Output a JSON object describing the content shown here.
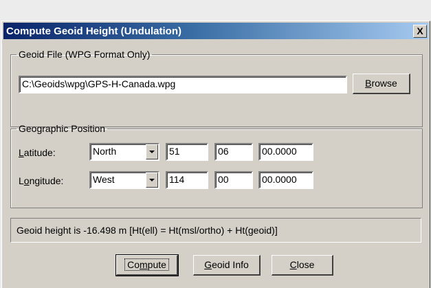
{
  "window": {
    "title": "Compute Geoid Height (Undulation)",
    "close_label": "X"
  },
  "geoid_file": {
    "legend": "Geoid File (WPG Format Only)",
    "path": "C:\\Geoids\\wpg\\GPS-H-Canada.wpg",
    "browse": {
      "pre": "",
      "key": "B",
      "post": "rowse"
    }
  },
  "position": {
    "legend": "Geographic Position",
    "latitude": {
      "label": {
        "pre": "",
        "key": "L",
        "post": "atitude:"
      },
      "hemisphere": "North",
      "deg": "51",
      "min": "06",
      "sec": "00.0000"
    },
    "longitude": {
      "label": {
        "pre": "L",
        "key": "o",
        "post": "ngitude:"
      },
      "hemisphere": "West",
      "deg": "114",
      "min": "00",
      "sec": "00.0000"
    }
  },
  "result": "Geoid height is -16.498 m  [Ht(ell) = Ht(msl/ortho) + Ht(geoid)]",
  "buttons": {
    "compute": {
      "pre": "Co",
      "key": "m",
      "post": "pute"
    },
    "geoid_info": {
      "pre": "",
      "key": "G",
      "post": "eoid Info"
    },
    "close": {
      "pre": "",
      "key": "C",
      "post": "lose"
    }
  }
}
